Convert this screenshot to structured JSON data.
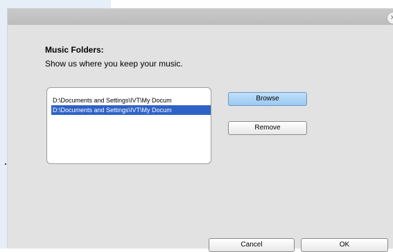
{
  "dialog": {
    "close_glyph": "×",
    "heading": "Music Folders:",
    "subtext": "Show us where you keep your music.",
    "folders": [
      {
        "path": "D:\\Documents and Settings\\IVT\\My Docum",
        "selected": false
      },
      {
        "path": "D:\\Documents and Settings\\IVT\\My Docum",
        "selected": true
      }
    ],
    "buttons": {
      "browse": "Browse",
      "remove": "Remove",
      "cancel": "Cancel",
      "ok": "OK"
    }
  },
  "colors": {
    "accent": "#2f62c7",
    "primary_button": "#9cc9f1",
    "dialog_bg": "#e2e2e2",
    "titlebar": "#c3c3c3"
  }
}
